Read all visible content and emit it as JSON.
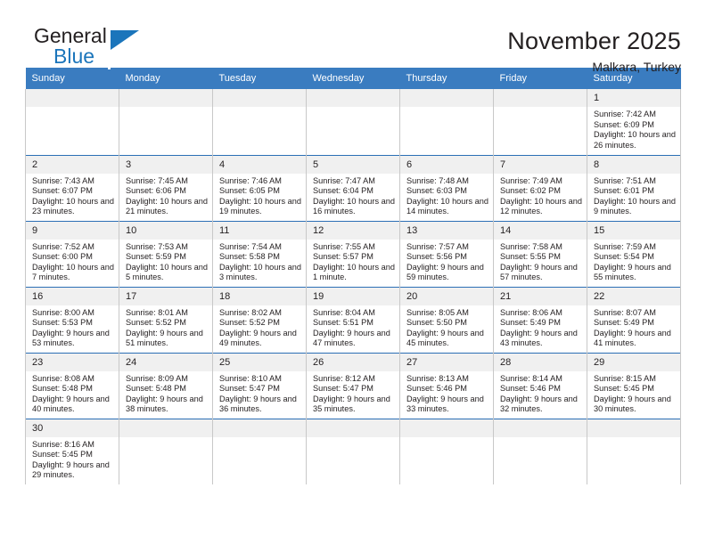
{
  "brand": {
    "name_top": "General",
    "name_bottom": "Blue",
    "accent_color": "#1b75bb",
    "logo_icon": "triangle-flag-icon"
  },
  "header": {
    "title": "November 2025",
    "subtitle": "Malkara, Turkey"
  },
  "colors": {
    "header_row_bg": "#3a7cc0",
    "daynum_bg": "#f0f0f0",
    "row_divider": "#2b6fb5",
    "cell_border": "#c8c8c8",
    "text": "#231f20"
  },
  "weekdays": [
    "Sunday",
    "Monday",
    "Tuesday",
    "Wednesday",
    "Thursday",
    "Friday",
    "Saturday"
  ],
  "weeks": [
    [
      {
        "day": "",
        "empty": true
      },
      {
        "day": "",
        "empty": true
      },
      {
        "day": "",
        "empty": true
      },
      {
        "day": "",
        "empty": true
      },
      {
        "day": "",
        "empty": true
      },
      {
        "day": "",
        "empty": true
      },
      {
        "day": "1",
        "sunrise": "Sunrise: 7:42 AM",
        "sunset": "Sunset: 6:09 PM",
        "daylight": "Daylight: 10 hours and 26 minutes."
      }
    ],
    [
      {
        "day": "2",
        "sunrise": "Sunrise: 7:43 AM",
        "sunset": "Sunset: 6:07 PM",
        "daylight": "Daylight: 10 hours and 23 minutes."
      },
      {
        "day": "3",
        "sunrise": "Sunrise: 7:45 AM",
        "sunset": "Sunset: 6:06 PM",
        "daylight": "Daylight: 10 hours and 21 minutes."
      },
      {
        "day": "4",
        "sunrise": "Sunrise: 7:46 AM",
        "sunset": "Sunset: 6:05 PM",
        "daylight": "Daylight: 10 hours and 19 minutes."
      },
      {
        "day": "5",
        "sunrise": "Sunrise: 7:47 AM",
        "sunset": "Sunset: 6:04 PM",
        "daylight": "Daylight: 10 hours and 16 minutes."
      },
      {
        "day": "6",
        "sunrise": "Sunrise: 7:48 AM",
        "sunset": "Sunset: 6:03 PM",
        "daylight": "Daylight: 10 hours and 14 minutes."
      },
      {
        "day": "7",
        "sunrise": "Sunrise: 7:49 AM",
        "sunset": "Sunset: 6:02 PM",
        "daylight": "Daylight: 10 hours and 12 minutes."
      },
      {
        "day": "8",
        "sunrise": "Sunrise: 7:51 AM",
        "sunset": "Sunset: 6:01 PM",
        "daylight": "Daylight: 10 hours and 9 minutes."
      }
    ],
    [
      {
        "day": "9",
        "sunrise": "Sunrise: 7:52 AM",
        "sunset": "Sunset: 6:00 PM",
        "daylight": "Daylight: 10 hours and 7 minutes."
      },
      {
        "day": "10",
        "sunrise": "Sunrise: 7:53 AM",
        "sunset": "Sunset: 5:59 PM",
        "daylight": "Daylight: 10 hours and 5 minutes."
      },
      {
        "day": "11",
        "sunrise": "Sunrise: 7:54 AM",
        "sunset": "Sunset: 5:58 PM",
        "daylight": "Daylight: 10 hours and 3 minutes."
      },
      {
        "day": "12",
        "sunrise": "Sunrise: 7:55 AM",
        "sunset": "Sunset: 5:57 PM",
        "daylight": "Daylight: 10 hours and 1 minute."
      },
      {
        "day": "13",
        "sunrise": "Sunrise: 7:57 AM",
        "sunset": "Sunset: 5:56 PM",
        "daylight": "Daylight: 9 hours and 59 minutes."
      },
      {
        "day": "14",
        "sunrise": "Sunrise: 7:58 AM",
        "sunset": "Sunset: 5:55 PM",
        "daylight": "Daylight: 9 hours and 57 minutes."
      },
      {
        "day": "15",
        "sunrise": "Sunrise: 7:59 AM",
        "sunset": "Sunset: 5:54 PM",
        "daylight": "Daylight: 9 hours and 55 minutes."
      }
    ],
    [
      {
        "day": "16",
        "sunrise": "Sunrise: 8:00 AM",
        "sunset": "Sunset: 5:53 PM",
        "daylight": "Daylight: 9 hours and 53 minutes."
      },
      {
        "day": "17",
        "sunrise": "Sunrise: 8:01 AM",
        "sunset": "Sunset: 5:52 PM",
        "daylight": "Daylight: 9 hours and 51 minutes."
      },
      {
        "day": "18",
        "sunrise": "Sunrise: 8:02 AM",
        "sunset": "Sunset: 5:52 PM",
        "daylight": "Daylight: 9 hours and 49 minutes."
      },
      {
        "day": "19",
        "sunrise": "Sunrise: 8:04 AM",
        "sunset": "Sunset: 5:51 PM",
        "daylight": "Daylight: 9 hours and 47 minutes."
      },
      {
        "day": "20",
        "sunrise": "Sunrise: 8:05 AM",
        "sunset": "Sunset: 5:50 PM",
        "daylight": "Daylight: 9 hours and 45 minutes."
      },
      {
        "day": "21",
        "sunrise": "Sunrise: 8:06 AM",
        "sunset": "Sunset: 5:49 PM",
        "daylight": "Daylight: 9 hours and 43 minutes."
      },
      {
        "day": "22",
        "sunrise": "Sunrise: 8:07 AM",
        "sunset": "Sunset: 5:49 PM",
        "daylight": "Daylight: 9 hours and 41 minutes."
      }
    ],
    [
      {
        "day": "23",
        "sunrise": "Sunrise: 8:08 AM",
        "sunset": "Sunset: 5:48 PM",
        "daylight": "Daylight: 9 hours and 40 minutes."
      },
      {
        "day": "24",
        "sunrise": "Sunrise: 8:09 AM",
        "sunset": "Sunset: 5:48 PM",
        "daylight": "Daylight: 9 hours and 38 minutes."
      },
      {
        "day": "25",
        "sunrise": "Sunrise: 8:10 AM",
        "sunset": "Sunset: 5:47 PM",
        "daylight": "Daylight: 9 hours and 36 minutes."
      },
      {
        "day": "26",
        "sunrise": "Sunrise: 8:12 AM",
        "sunset": "Sunset: 5:47 PM",
        "daylight": "Daylight: 9 hours and 35 minutes."
      },
      {
        "day": "27",
        "sunrise": "Sunrise: 8:13 AM",
        "sunset": "Sunset: 5:46 PM",
        "daylight": "Daylight: 9 hours and 33 minutes."
      },
      {
        "day": "28",
        "sunrise": "Sunrise: 8:14 AM",
        "sunset": "Sunset: 5:46 PM",
        "daylight": "Daylight: 9 hours and 32 minutes."
      },
      {
        "day": "29",
        "sunrise": "Sunrise: 8:15 AM",
        "sunset": "Sunset: 5:45 PM",
        "daylight": "Daylight: 9 hours and 30 minutes."
      }
    ],
    [
      {
        "day": "30",
        "sunrise": "Sunrise: 8:16 AM",
        "sunset": "Sunset: 5:45 PM",
        "daylight": "Daylight: 9 hours and 29 minutes."
      },
      {
        "day": "",
        "empty": true
      },
      {
        "day": "",
        "empty": true
      },
      {
        "day": "",
        "empty": true
      },
      {
        "day": "",
        "empty": true
      },
      {
        "day": "",
        "empty": true
      },
      {
        "day": "",
        "empty": true
      }
    ]
  ]
}
